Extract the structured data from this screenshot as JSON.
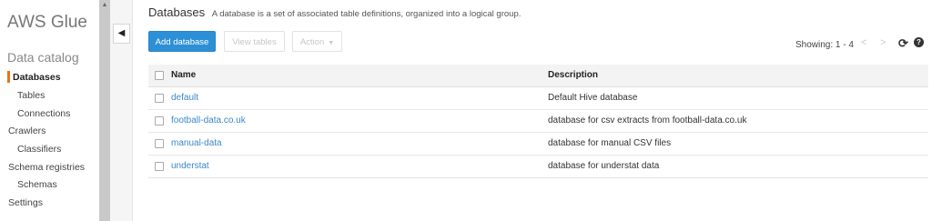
{
  "sidebar": {
    "app_title": "AWS Glue",
    "section_title": "Data catalog",
    "items": [
      {
        "label": "Databases"
      },
      {
        "label": "Tables"
      },
      {
        "label": "Connections"
      },
      {
        "label": "Crawlers"
      },
      {
        "label": "Classifiers"
      },
      {
        "label": "Schema registries"
      },
      {
        "label": "Schemas"
      },
      {
        "label": "Settings"
      }
    ],
    "active_color": "#ec7211"
  },
  "header": {
    "title": "Databases",
    "description": "A database is a set of associated table definitions, organized into a logical group."
  },
  "toolbar": {
    "add_label": "Add database",
    "view_label": "View tables",
    "action_label": "Action",
    "primary_color": "#2d90d6"
  },
  "pagination": {
    "showing": "Showing: 1 - 4"
  },
  "table": {
    "columns": [
      "Name",
      "Description"
    ],
    "rows": [
      {
        "name": "default",
        "description": "Default Hive database"
      },
      {
        "name": "football-data.co.uk",
        "description": "database for csv extracts from football-data.co.uk"
      },
      {
        "name": "manual-data",
        "description": "database for manual CSV files"
      },
      {
        "name": "understat",
        "description": "database for understat data"
      }
    ],
    "link_color": "#3b87c8"
  },
  "icons": {
    "collapse": "chevron-left-icon",
    "refresh": "refresh-icon",
    "help": "help-icon"
  }
}
